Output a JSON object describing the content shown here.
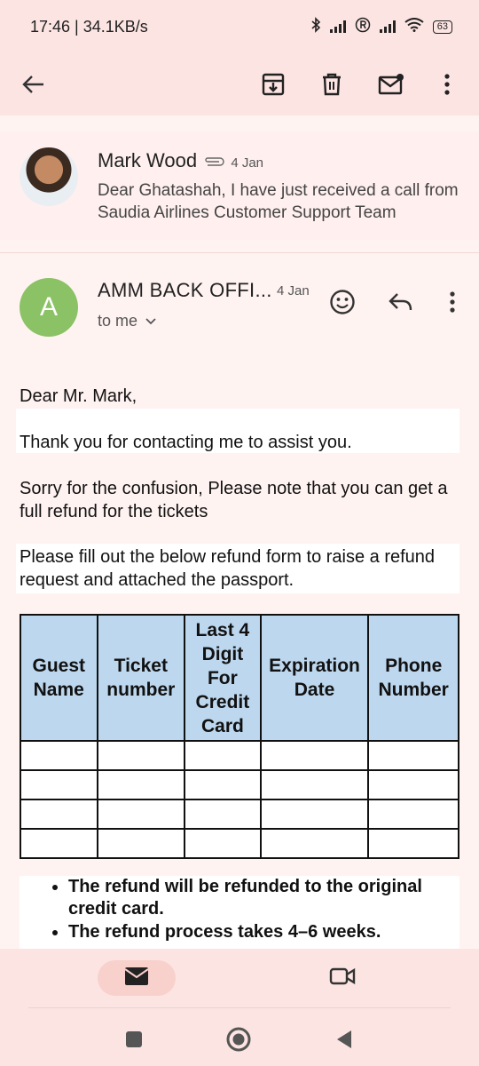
{
  "status": {
    "time_speed": "17:46 | 34.1KB/s",
    "battery": "63"
  },
  "thread": {
    "sender": "Mark Wood",
    "date": "4 Jan",
    "snippet": "Dear Ghatashah, I have just received a call from Saudia Airlines Customer Support Team"
  },
  "message": {
    "avatar_letter": "A",
    "sender": "AMM BACK OFFI...",
    "date": "4 Jan",
    "recipient": "to me",
    "greeting": "Dear Mr. Mark,",
    "para1": "Thank you for contacting me to assist you.",
    "para2": "Sorry for the confusion, Please note that you can get a full refund for the tickets",
    "para3": "Please fill out the below refund form to raise a refund request and attached the passport.",
    "table": {
      "headers": [
        "Guest Name",
        "Ticket number",
        "Last 4 Digit For Credit Card",
        "Expiration Date",
        "Phone Number"
      ],
      "rows": [
        [
          "",
          "",
          "",
          "",
          ""
        ],
        [
          "",
          "",
          "",
          "",
          ""
        ],
        [
          "",
          "",
          "",
          "",
          ""
        ],
        [
          "",
          "",
          "",
          "",
          ""
        ]
      ]
    },
    "bullets": [
      "The refund will be refunded to the original credit card.",
      "The refund process takes 4–6 weeks."
    ]
  },
  "colors": {
    "accent_bg": "#fce4e2",
    "avatar_green": "#8bc266",
    "table_header": "#bdd7ee"
  },
  "icons": {
    "toolbar": [
      "back-arrow-icon",
      "archive-icon",
      "delete-icon",
      "mark-unread-icon",
      "more-vert-icon"
    ],
    "message": [
      "emoji-react-icon",
      "reply-icon",
      "more-vert-icon"
    ],
    "nav": [
      "mail-icon",
      "video-icon"
    ],
    "system": [
      "recents-icon",
      "home-icon",
      "back-icon"
    ]
  }
}
